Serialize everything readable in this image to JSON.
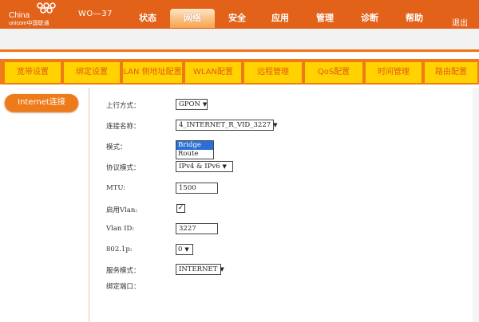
{
  "brand": {
    "china": "China",
    "unicom": "unicom中国联通",
    "model": "WO—37"
  },
  "nav": [
    {
      "label": "状态",
      "active": false
    },
    {
      "label": "网络",
      "active": true
    },
    {
      "label": "安全",
      "active": false
    },
    {
      "label": "应用",
      "active": false
    },
    {
      "label": "管理",
      "active": false
    },
    {
      "label": "诊断",
      "active": false
    },
    {
      "label": "帮助",
      "active": false
    }
  ],
  "exit_label": "退出",
  "subnav": [
    "宽带设置",
    "绑定设置",
    "LAN 侧地址配置",
    "WLAN配置",
    "远程管理",
    "QoS配置",
    "时间管理",
    "路由配置"
  ],
  "sidebar": {
    "item": "Internet连接"
  },
  "form": {
    "uplink_label": "上行方式：",
    "uplink_value": "GPON",
    "conn_name_label": "连接名称：",
    "conn_name_value": "4_INTERNET_R_VID_3227",
    "mode_label": "模式：",
    "mode_options": [
      "Bridge",
      "Route"
    ],
    "mode_selected": "Bridge",
    "protocol_label": "协议模式：",
    "protocol_value": "IPv4 & IPv6",
    "mtu_label": "MTU:",
    "mtu_value": "1500",
    "vlan_enable_label": "启用Vlan:",
    "vlan_enable_checked": true,
    "vlan_id_label": "Vlan ID:",
    "vlan_id_value": "3227",
    "p8021_label": "802.1p:",
    "p8021_value": "0",
    "service_label": "服务模式：",
    "service_value": "INTERNET",
    "bind_port_label": "绑定端口："
  },
  "colors": {
    "brand_orange": "#e2621a",
    "tab_yellow": "#ffd200",
    "tab_text": "#e25b14",
    "selected_blue": "#2a6fd6"
  }
}
